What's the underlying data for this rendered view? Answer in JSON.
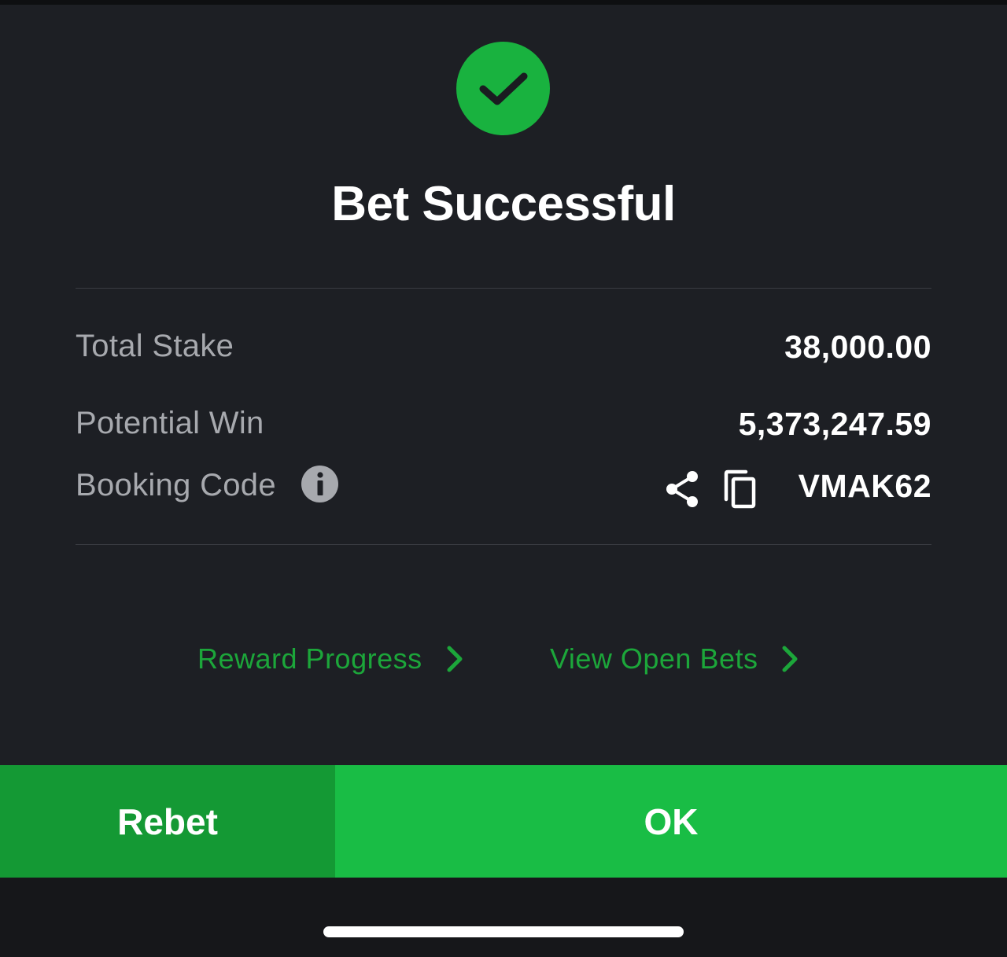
{
  "dialog": {
    "title": "Bet Successful",
    "status_icon": "check-circle-icon",
    "accent_color": "#19b23f"
  },
  "summary": {
    "total_stake_label": "Total Stake",
    "total_stake_value": "38,000.00",
    "potential_win_label": "Potential Win",
    "potential_win_value": "5,373,247.59",
    "booking_code_label": "Booking Code",
    "booking_code_value": "VMAK62",
    "icons": [
      "info-icon",
      "share-icon",
      "copy-icon"
    ]
  },
  "links": {
    "reward_progress": "Reward Progress",
    "view_open_bets": "View Open Bets",
    "color": "#1ca63a"
  },
  "buttons": {
    "rebet": "Rebet",
    "ok": "OK",
    "rebet_color": "#149934",
    "ok_color": "#19bd45"
  }
}
